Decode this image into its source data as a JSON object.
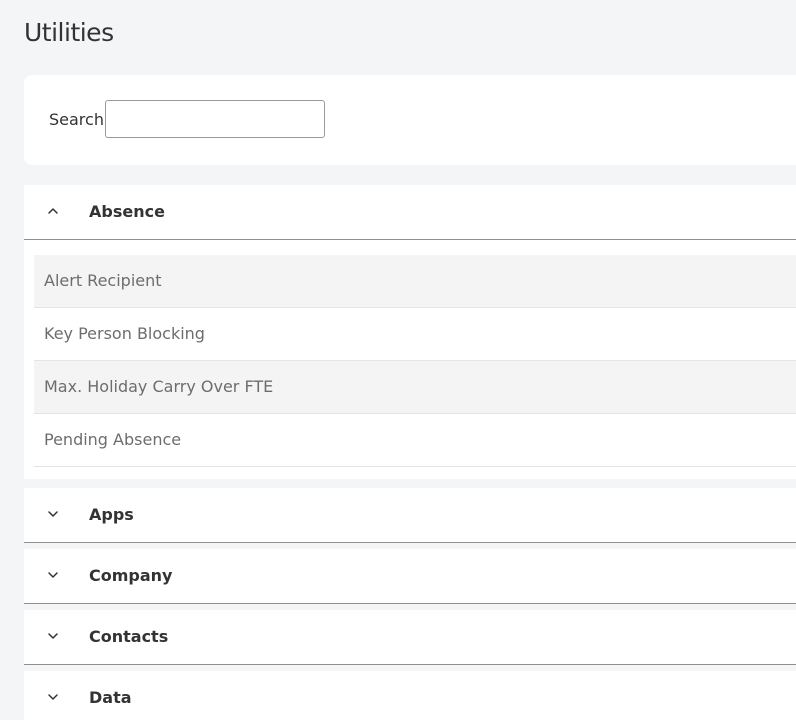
{
  "page": {
    "title": "Utilities"
  },
  "search": {
    "label": "Search",
    "value": "",
    "placeholder": ""
  },
  "sections": [
    {
      "title": "Absence",
      "expanded": true,
      "icon": "chevron-up-icon",
      "items": [
        {
          "label": "Alert Recipient"
        },
        {
          "label": "Key Person Blocking"
        },
        {
          "label": "Max. Holiday Carry Over FTE"
        },
        {
          "label": "Pending Absence"
        }
      ]
    },
    {
      "title": "Apps",
      "expanded": false,
      "icon": "chevron-down-icon"
    },
    {
      "title": "Company",
      "expanded": false,
      "icon": "chevron-down-icon"
    },
    {
      "title": "Contacts",
      "expanded": false,
      "icon": "chevron-down-icon"
    },
    {
      "title": "Data",
      "expanded": false,
      "icon": "chevron-down-icon"
    }
  ],
  "colors": {
    "background": "#f4f5f6",
    "card": "#ffffff",
    "text": "#333333",
    "item_text": "#6d6d6d",
    "row_shade": "#f4f4f4",
    "divider": "#8f8f8f"
  }
}
